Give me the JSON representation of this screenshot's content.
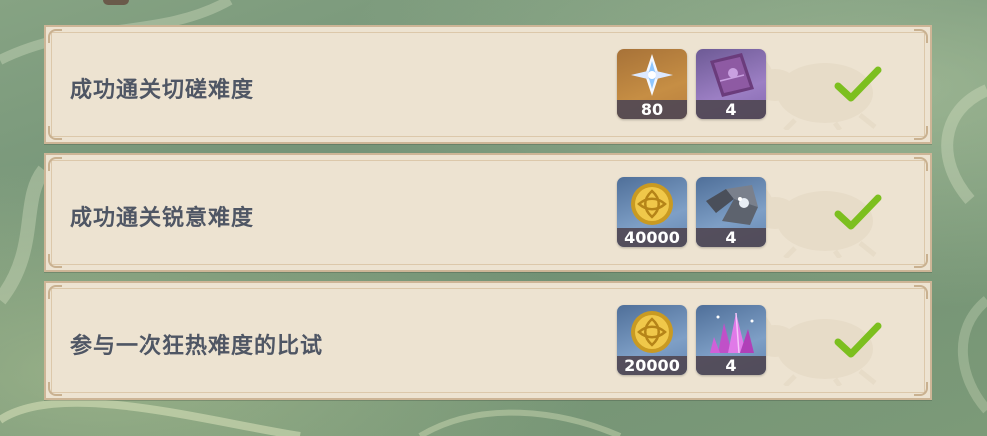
{
  "tasks": [
    {
      "label": "成功通关切磋难度",
      "completed": true,
      "rewards": [
        {
          "item": "primogem-icon",
          "count": "80",
          "rarity_color": "#c68e44"
        },
        {
          "item": "heros-wit-book-icon",
          "count": "4",
          "rarity_color": "#9c7fc4"
        }
      ]
    },
    {
      "label": "成功通关锐意难度",
      "completed": true,
      "rewards": [
        {
          "item": "mora-coin-icon",
          "count": "40000",
          "rarity_color": "#7e9fc6"
        },
        {
          "item": "enhancement-ore-icon",
          "count": "4",
          "rarity_color": "#7e9fc6"
        }
      ]
    },
    {
      "label": "参与一次狂热难度的比试",
      "completed": true,
      "rewards": [
        {
          "item": "mora-coin-icon",
          "count": "20000",
          "rarity_color": "#7e9fc6"
        },
        {
          "item": "crystal-chunk-icon",
          "count": "4",
          "rarity_color": "#7e9fc6"
        }
      ]
    }
  ],
  "colors": {
    "panel": "#ede3d1",
    "panel_border": "#cdb596",
    "label_text": "#4f5664",
    "check": "#7cbf1f"
  }
}
